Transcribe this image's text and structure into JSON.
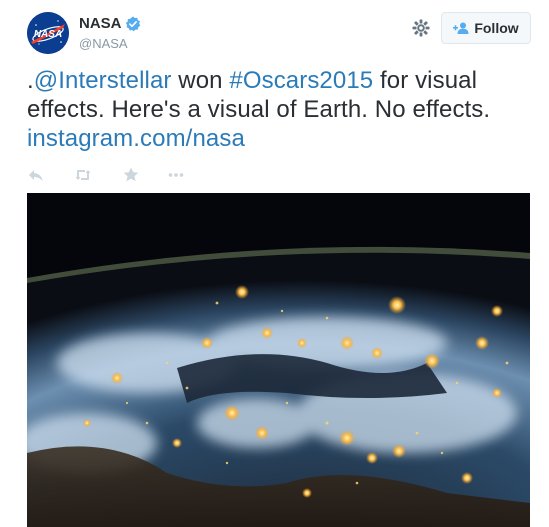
{
  "user": {
    "name": "NASA",
    "handle": "@NASA",
    "avatar_text": "NASA"
  },
  "follow_button": {
    "label": "Follow"
  },
  "tweet": {
    "prefix": ".",
    "mention": "@Interstellar",
    "text_mid1": " won ",
    "hashtag": "#Oscars2015",
    "text_mid2": " for visual effects. Here's a visual of Earth. No effects. ",
    "link": "instagram.com/nasa"
  },
  "colors": {
    "link": "#2b7bb9",
    "verified": "#55acee",
    "text": "#292f33",
    "muted": "#8899a6",
    "action_icon": "#ccd6dd"
  },
  "icons": [
    "verified-badge-icon",
    "gear-icon",
    "follow-person-icon",
    "reply-icon",
    "retweet-icon",
    "favorite-star-icon",
    "more-icon"
  ]
}
